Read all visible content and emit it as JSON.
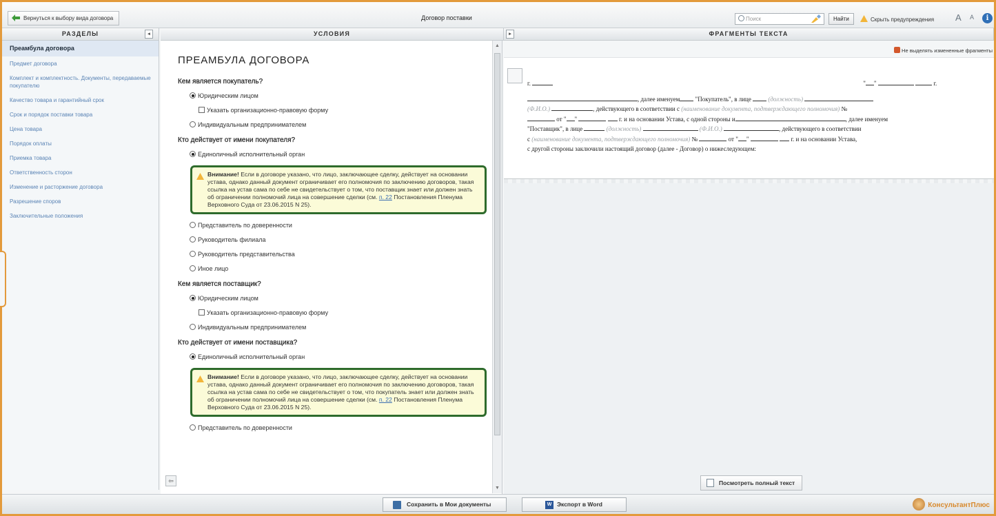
{
  "topbar": {
    "back_label": "Вернуться к выбору вида договора",
    "title": "Договор поставки",
    "search_placeholder": "Поиск",
    "find_label": "Найти",
    "hide_warnings_label": "Скрыть предупреждения"
  },
  "panes": {
    "sections_header": "РАЗДЕЛЫ",
    "conditions_header": "УСЛОВИЯ",
    "fragments_header": "ФРАГМЕНТЫ ТЕКСТА"
  },
  "sections": [
    {
      "label": "Преамбула договора",
      "active": true
    },
    {
      "label": "Предмет договора"
    },
    {
      "label": "Комплект и комплектность. Документы, передаваемые покупателю"
    },
    {
      "label": "Качество товара и гарантийный срок"
    },
    {
      "label": "Срок и порядок поставки товара"
    },
    {
      "label": "Цена товара"
    },
    {
      "label": "Порядок оплаты"
    },
    {
      "label": "Приемка товара"
    },
    {
      "label": "Ответственность сторон"
    },
    {
      "label": "Изменение и расторжение договора"
    },
    {
      "label": "Разрешение споров"
    },
    {
      "label": "Заключительные положения"
    }
  ],
  "conditions": {
    "title": "ПРЕАМБУЛА ДОГОВОРА",
    "q1": "Кем является покупатель?",
    "q1_opt1": "Юридическим лицом",
    "q1_sub": "Указать организационно-правовую форму",
    "q1_opt2": "Индивидуальным предпринимателем",
    "q2": "Кто действует от имени покупателя?",
    "q2_opt1": "Единоличный исполнительный орган",
    "warn1_bold": "Внимание!",
    "warn1_text": " Если в договоре указано, что лицо, заключающее сделку, действует на основании устава, однако данный документ ограничивает его полномочия по заключению договоров, такая ссылка на устав сама по себе не свидетельствует о том, что поставщик знает или должен знать об ограничении полномочий лица на совершение сделки (см. ",
    "warn_link": "п. 22",
    "warn_tail": " Постановления Пленума Верховного Суда от 23.06.2015 N 25).",
    "q2_opt2": "Представитель по доверенности",
    "q2_opt3": "Руководитель филиала",
    "q2_opt4": "Руководитель представительства",
    "q2_opt5": "Иное лицо",
    "q3": "Кем является поставщик?",
    "q3_opt1": "Юридическим лицом",
    "q3_sub": "Указать организационно-правовую форму",
    "q3_opt2": "Индивидуальным предпринимателем",
    "q4": "Кто действует от имени поставщика?",
    "q4_opt1": "Единоличный исполнительный орган",
    "warn2_bold": "Внимание!",
    "warn2_text": " Если в договоре указано, что лицо, заключающее сделку, действует на основании устава, однако данный документ ограничивает его полномочия по заключению договоров, такая ссылка на устав сама по себе не свидетельствует о том, что покупатель знает или должен знать об ограничении полномочий лица на совершение сделки (см. ",
    "q4_opt2": "Представитель по доверенности"
  },
  "fragments": {
    "no_highlight_label": "Не выделять измененные фрагменты",
    "full_text_label": "Посмотреть полный текст",
    "t_g": "г.",
    "t_quote": "\"",
    "t_after_name": ", далее именуем",
    "t_buyer": "\"Покупатель\", в лице",
    "t_pos": "(должность)",
    "t_fio": "(Ф.И.О.)",
    "t_acting": ", действующего в соответствии с",
    "t_doc": "(наименование документа, подтверждающего полномочия)",
    "t_no": "№",
    "t_from": "от",
    "t_basis": "г. и на основании Устава, с одной стороны и",
    "t_named2": ", далее именуем",
    "t_supplier": "\"Поставщик\", в лице",
    "t_acting2": ", действующего в соответствии",
    "t_c": "с",
    "t_basis2": "г. и на основании Устава,",
    "t_last": "с другой стороны заключили настоящий договор (далее - Договор) о нижеследующем:"
  },
  "bottombar": {
    "save_label": "Сохранить в Мои документы",
    "word_label": "Экспорт в Word",
    "brand": "КонсультантПлюс"
  }
}
